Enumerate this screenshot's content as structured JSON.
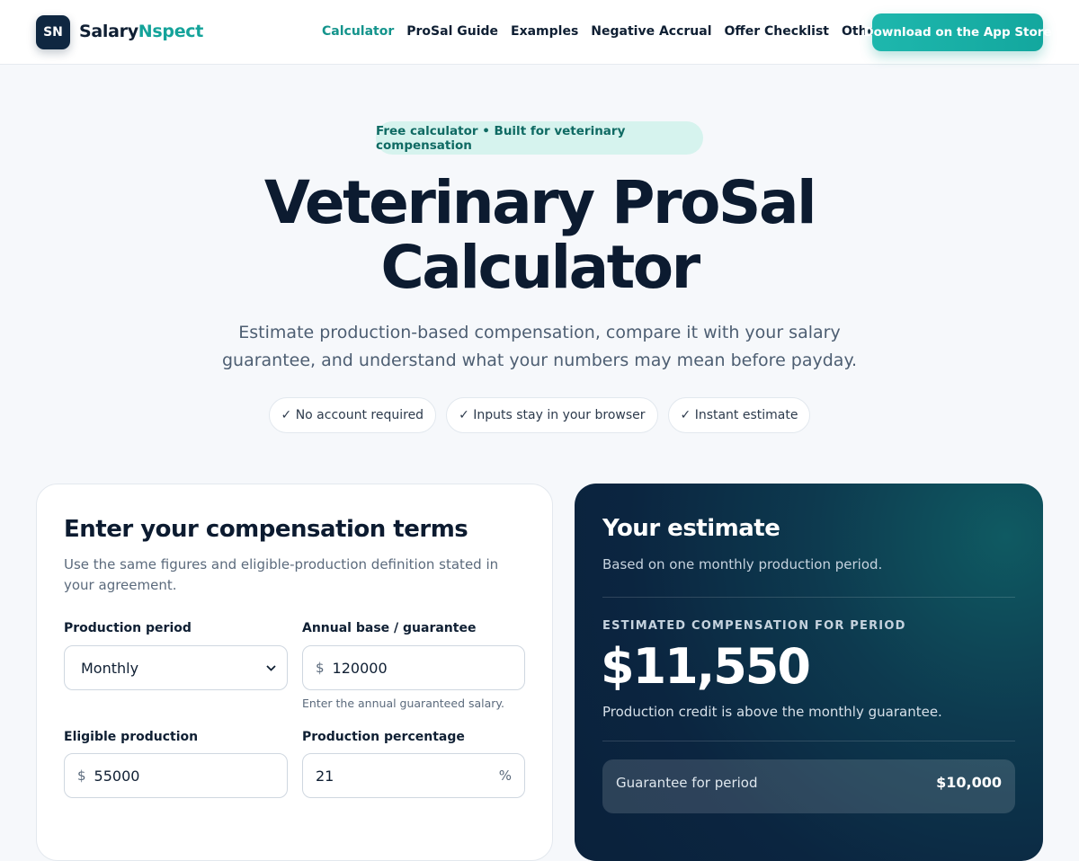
{
  "header": {
    "logo_badge": "SN",
    "brand_part1": "Salary",
    "brand_part2": "Nspect",
    "nav": [
      {
        "label": "Calculator",
        "active": true
      },
      {
        "label": "ProSal Guide",
        "active": false
      },
      {
        "label": "Examples",
        "active": false
      },
      {
        "label": "Negative Accrual",
        "active": false
      },
      {
        "label": "Offer Checklist",
        "active": false
      },
      {
        "label": "Other Careers",
        "active": false
      }
    ],
    "cta_label": "Download on the App Store"
  },
  "hero": {
    "pill": "Free calculator • Built for veterinary compensation",
    "title_line1": "Veterinary ProSal",
    "title_line2": "Calculator",
    "subtitle": "Estimate production-based compensation, compare it with your salary guarantee, and understand what your numbers may mean before payday.",
    "chips": [
      "✓ No account required",
      "✓ Inputs stay in your browser",
      "✓ Instant estimate"
    ]
  },
  "form": {
    "title": "Enter your compensation terms",
    "description": "Use the same figures and eligible-production definition stated in your agreement.",
    "period": {
      "label": "Production period",
      "value": "Monthly"
    },
    "base": {
      "label": "Annual base / guarantee",
      "prefix": "$",
      "value": "120000",
      "hint": "Enter the annual guaranteed salary."
    },
    "production": {
      "label": "Eligible production",
      "prefix": "$",
      "value": "55000"
    },
    "percentage": {
      "label": "Production percentage",
      "value": "21",
      "suffix": "%"
    }
  },
  "estimate": {
    "title": "Your estimate",
    "description": "Based on one monthly production period.",
    "label": "ESTIMATED COMPENSATION FOR PERIOD",
    "amount": "$11,550",
    "note": "Production credit is above the monthly guarantee.",
    "rows": [
      {
        "label": "Guarantee for period",
        "value": "$10,000"
      }
    ]
  },
  "colors": {
    "accent": "#14a39a",
    "navy": "#0c1b30",
    "card_dark": "#0b2540"
  }
}
